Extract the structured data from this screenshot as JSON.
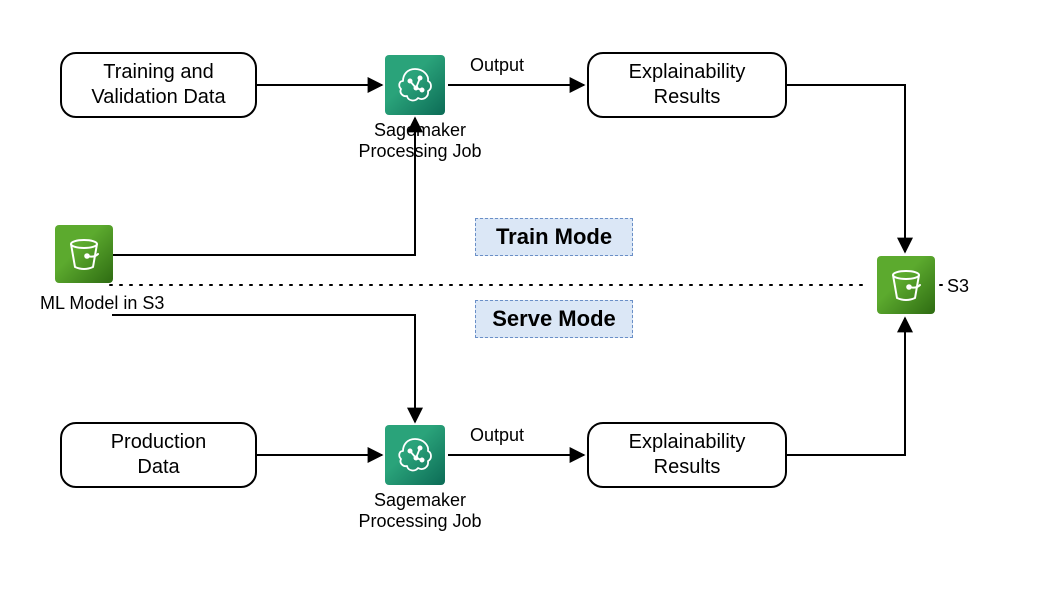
{
  "nodes": {
    "training_data": "Training and\nValidation Data",
    "production_data": "Production\nData",
    "explain_top": "Explainability\nResults",
    "explain_bottom": "Explainability\nResults",
    "ml_model_s3": "ML Model in S3",
    "sg_job_top": "Sagemaker\nProcessing Job",
    "sg_job_bottom": "Sagemaker\nProcessing Job",
    "s3_label": "S3"
  },
  "edge_labels": {
    "output_top": "Output",
    "output_bottom": "Output"
  },
  "modes": {
    "train": "Train Mode",
    "serve": "Serve Mode"
  },
  "icons": {
    "sagemaker": "sagemaker-icon",
    "s3_bucket": "s3-bucket-icon"
  }
}
